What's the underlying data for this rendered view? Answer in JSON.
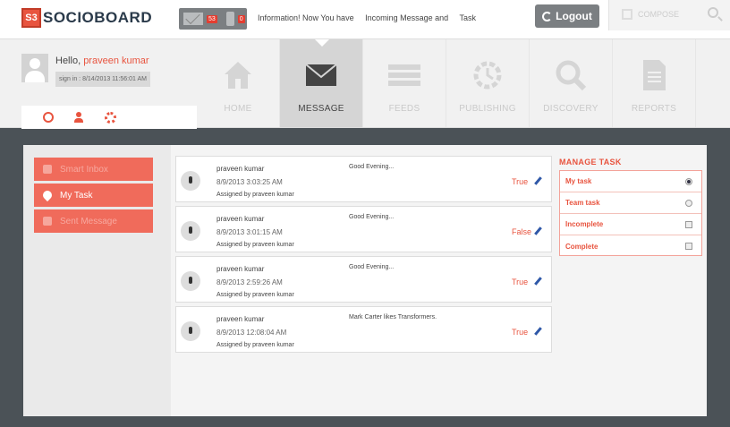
{
  "brand": {
    "badge": "S3",
    "name": "SOCIOBOARD"
  },
  "notifications": {
    "mail_count": "53",
    "phone_count": "0"
  },
  "marquee": "Information! Now You have     Incoming Message and     Task",
  "header": {
    "logout_label": "Logout",
    "compose_label": "COMPOSE"
  },
  "profile": {
    "greeting": "Hello,",
    "user_name": "praveen kumar",
    "signin": "sign in : 8/14/2013 11:56:01 AM"
  },
  "nav": {
    "tabs": [
      {
        "label": "HOME",
        "icon": "home-icon"
      },
      {
        "label": "MESSAGE",
        "icon": "envelope-icon",
        "active": true
      },
      {
        "label": "FEEDS",
        "icon": "feeds-icon"
      },
      {
        "label": "PUBLISHING",
        "icon": "publishing-icon"
      },
      {
        "label": "DISCOVERY",
        "icon": "search-icon"
      },
      {
        "label": "REPORTS",
        "icon": "document-icon"
      }
    ]
  },
  "left_menu": [
    {
      "label": "Smart Inbox",
      "icon": "chat-icon"
    },
    {
      "label": "My Task",
      "icon": "pin-icon"
    },
    {
      "label": "Sent Message",
      "icon": "mail-icon"
    }
  ],
  "tasks": [
    {
      "name": "praveen kumar",
      "date": "8/9/2013 3:03:25 AM",
      "assigned": "Assigned by praveen kumar",
      "message": "Good Evening...",
      "status": "True"
    },
    {
      "name": "praveen kumar",
      "date": "8/9/2013 3:01:15 AM",
      "assigned": "Assigned by praveen kumar",
      "message": "Good Evening...",
      "status": "False"
    },
    {
      "name": "praveen kumar",
      "date": "8/9/2013 2:59:26 AM",
      "assigned": "Assigned by praveen kumar",
      "message": "Good Evening...",
      "status": "True"
    },
    {
      "name": "praveen kumar",
      "date": "8/9/2013 12:08:04 AM",
      "assigned": "Assigned by praveen kumar",
      "message": "Mark Carter likes Transformers.",
      "status": "True"
    }
  ],
  "manage_task": {
    "title": "MANAGE TASK",
    "items": [
      {
        "label": "My task",
        "control": "radio",
        "checked": true
      },
      {
        "label": "Team task",
        "control": "radio",
        "checked": false
      },
      {
        "label": "Incomplete",
        "control": "checkbox",
        "checked": false
      },
      {
        "label": "Complete",
        "control": "checkbox",
        "checked": false
      }
    ]
  },
  "colors": {
    "accent": "#e8543f",
    "dark": "#4b5257"
  }
}
